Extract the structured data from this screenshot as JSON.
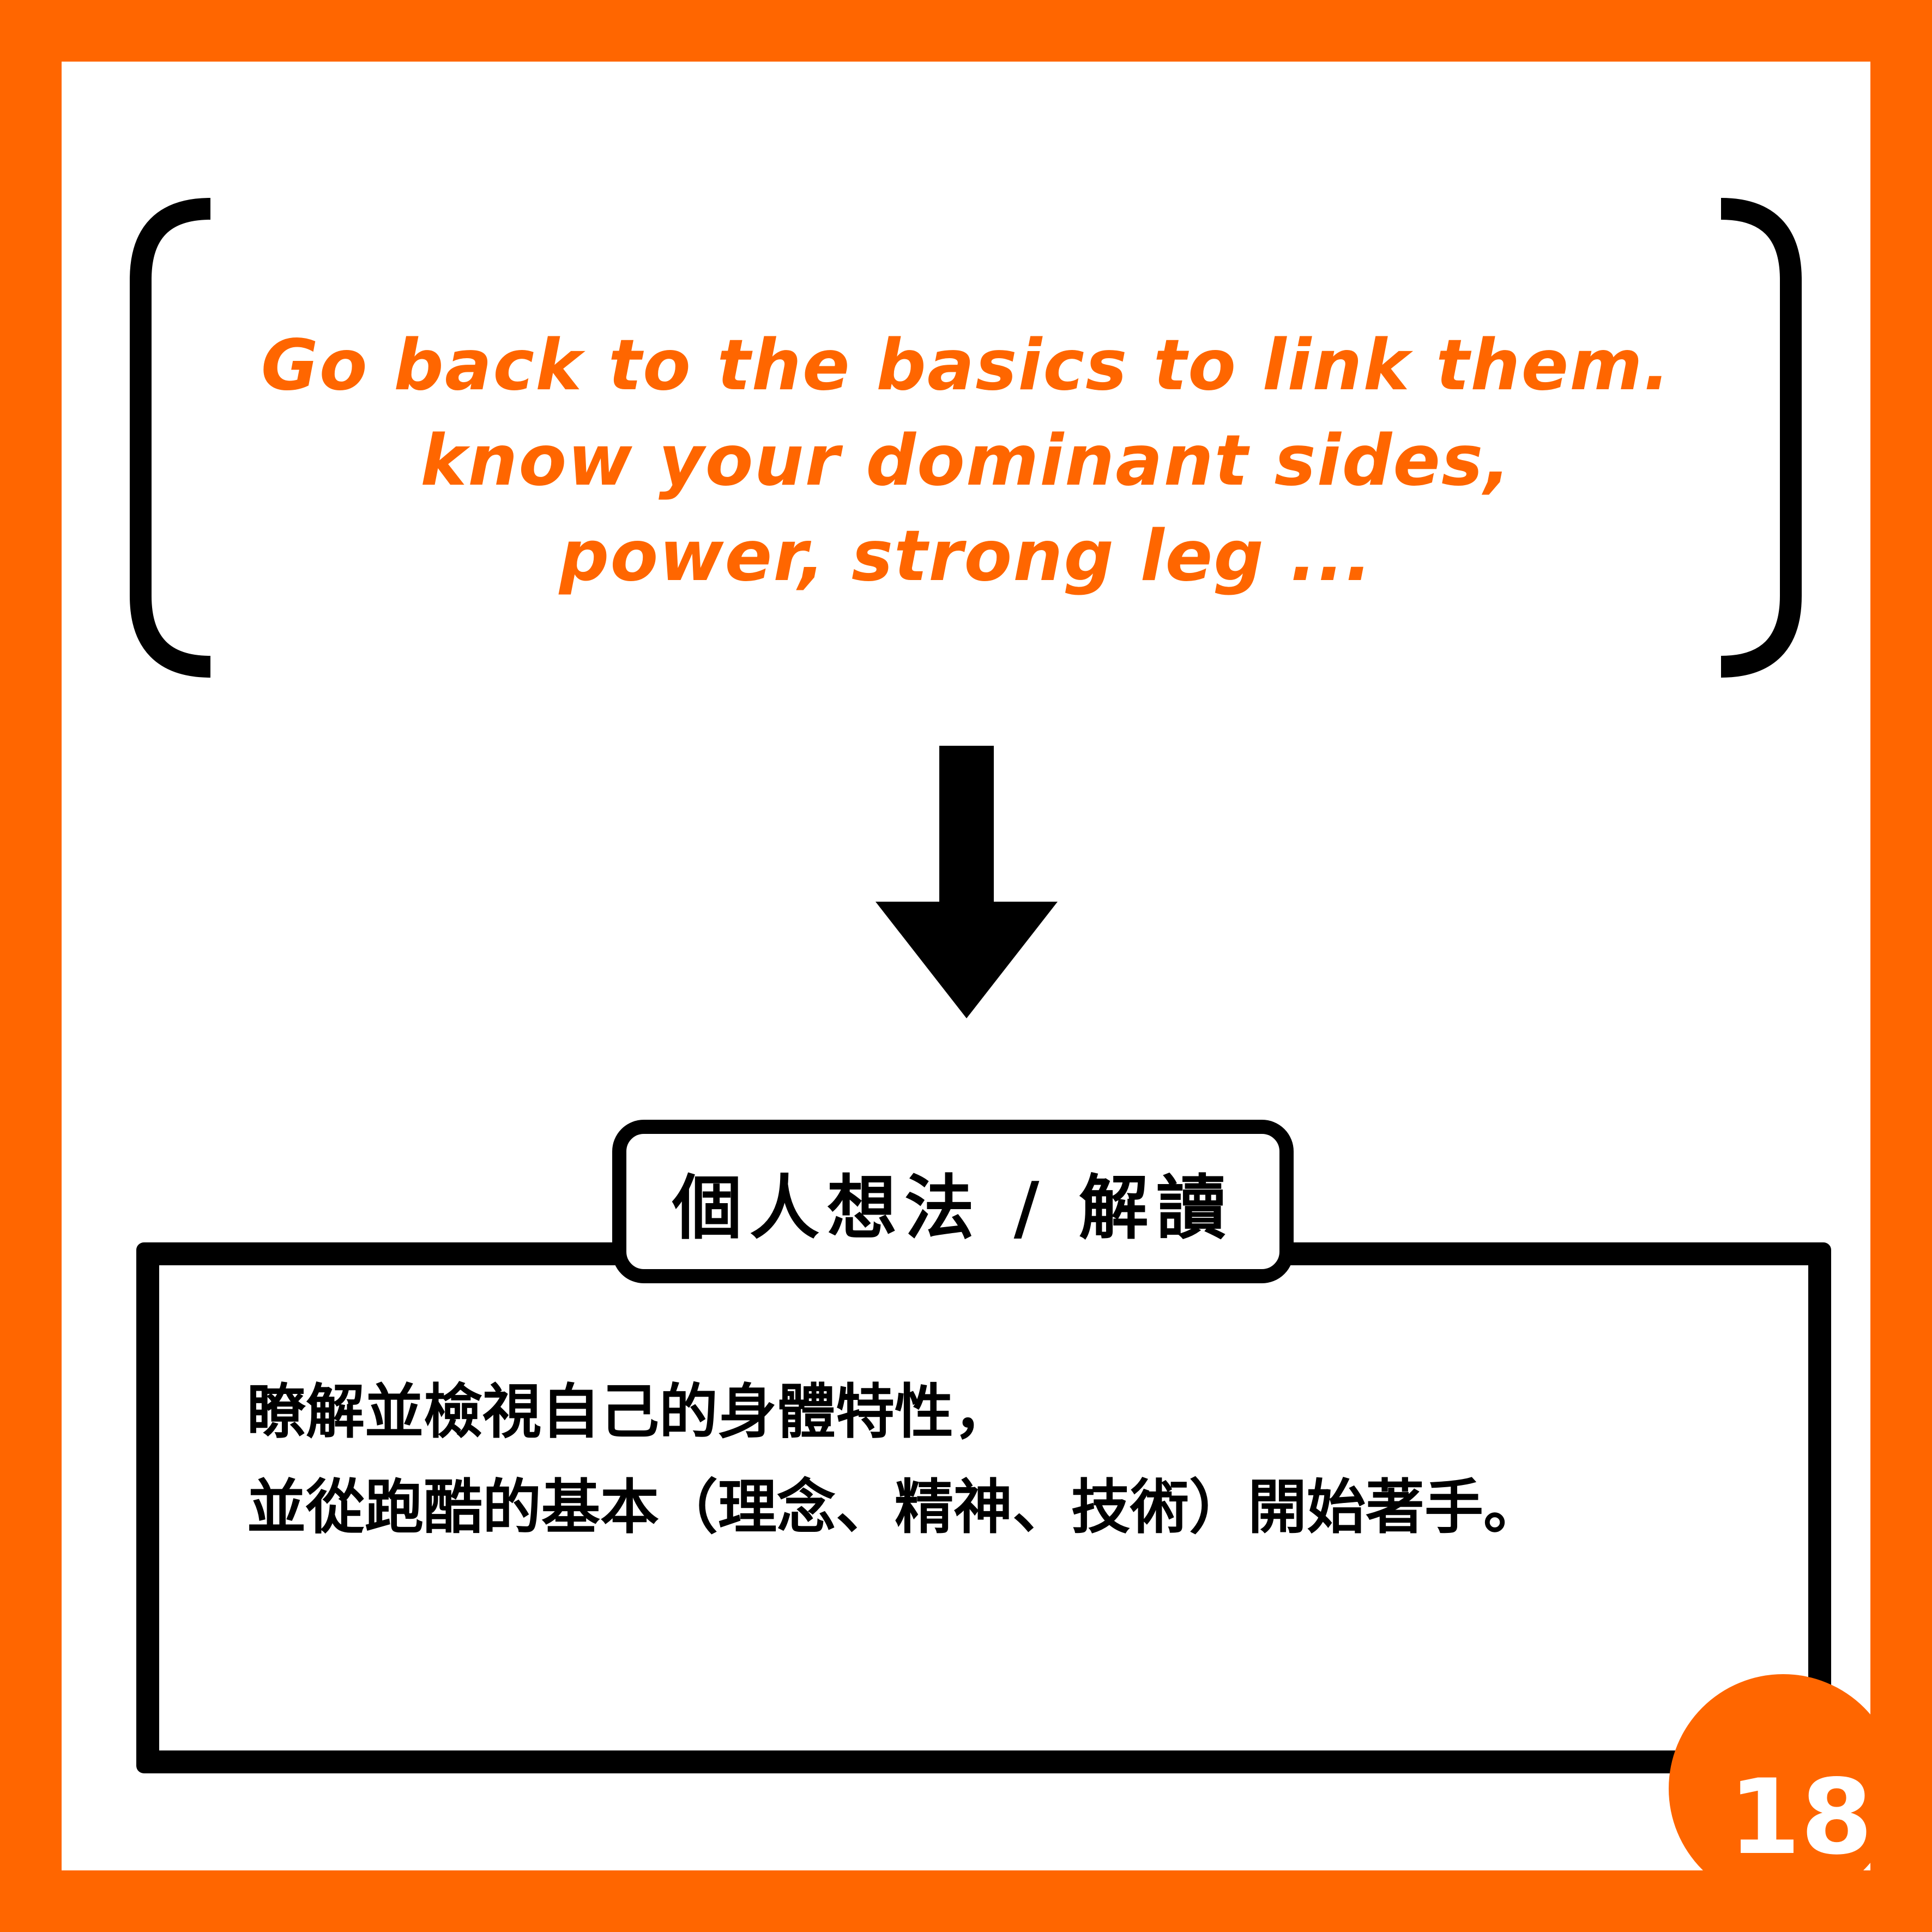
{
  "colors": {
    "accent": "#FF6600",
    "ink": "#000000",
    "paper": "#FFFFFF"
  },
  "quote": {
    "lines": [
      "Go back to the basics to link them.",
      "know your dominant sides,",
      "power, strong leg ..."
    ]
  },
  "note": {
    "label": "個人想法 / 解讀",
    "lines": [
      "瞭解並檢視自己的身體特性，",
      "並從跑酷的基本（理念、精神、技術）開始著手。"
    ]
  },
  "page_number": "18",
  "icons": {
    "left_bracket": "left-bracket",
    "right_bracket": "right-bracket",
    "arrow": "down-arrow-icon"
  }
}
